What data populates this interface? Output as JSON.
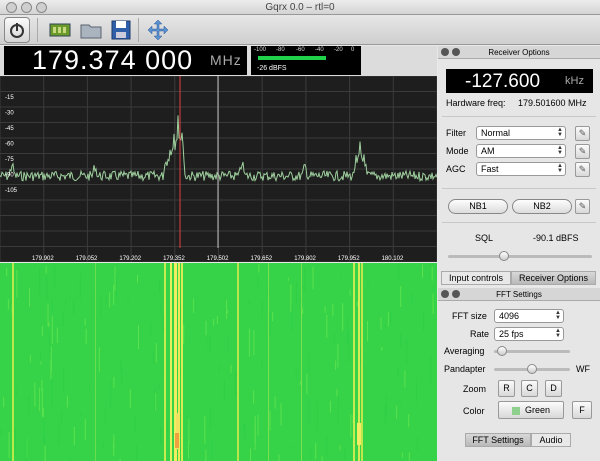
{
  "window": {
    "title": "Gqrx 0.0 – rtl=0"
  },
  "toolbar": {
    "icons": [
      "power-icon",
      "hardware-icon",
      "folder-icon",
      "save-icon",
      "fullscreen-icon"
    ]
  },
  "frequency": {
    "value": "179.374 000",
    "unit": "MHz"
  },
  "meter": {
    "scale": [
      "-100",
      "-80",
      "-60",
      "-40",
      "-20",
      "0"
    ],
    "reading": "-26 dBFS",
    "level_fraction": 0.74
  },
  "spectrum": {
    "y_labels": [
      "-15",
      "-30",
      "-45",
      "-60",
      "-75",
      "-90",
      "-105"
    ],
    "x_labels": [
      "179.902",
      "179.052",
      "179.202",
      "179.352",
      "179.502",
      "179.652",
      "179.802",
      "179.952",
      "180.102"
    ]
  },
  "receiver": {
    "title": "Receiver Options",
    "offset": "-127.600",
    "offset_unit": "kHz",
    "hw_label": "Hardware freq:",
    "hw_value": "179.501600 MHz",
    "filter_label": "Filter",
    "filter_value": "Normal",
    "mode_label": "Mode",
    "mode_value": "AM",
    "agc_label": "AGC",
    "agc_value": "Fast",
    "nb1": "NB1",
    "nb2": "NB2",
    "sql_label": "SQL",
    "sql_value": "-90.1 dBFS",
    "sql_fraction": 0.38
  },
  "upper_tabs": {
    "input": "Input controls",
    "receiver": "Receiver Options"
  },
  "fft": {
    "title": "FFT Settings",
    "size_label": "FFT size",
    "size_value": "4096",
    "rate_label": "Rate",
    "rate_value": "25 fps",
    "avg_label": "Averaging",
    "avg_fraction": 0.05,
    "pand_label": "Pandapter",
    "pand_fraction": 0.5,
    "wf_label": "WF",
    "zoom_label": "Zoom",
    "zoom_r": "R",
    "zoom_c": "C",
    "zoom_d": "D",
    "color_label": "Color",
    "color_value": "Green",
    "color_swatch": "#8fd08f",
    "f": "F"
  },
  "lower_tabs": {
    "fft": "FFT Settings",
    "audio": "Audio"
  }
}
